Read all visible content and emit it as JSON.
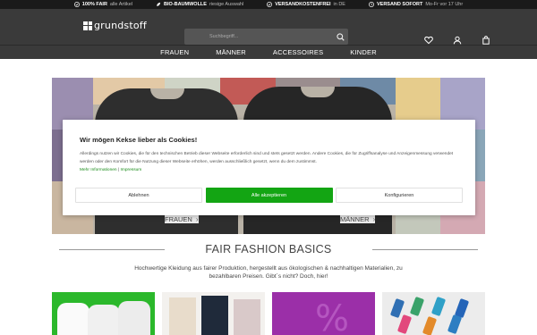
{
  "usp": [
    {
      "icon": "check-circle-icon",
      "bold": "100% FAIR",
      "thin": "alle Artikel"
    },
    {
      "icon": "leaf-icon",
      "bold": "BIO-BAUMWOLLE",
      "thin": "riesige Auswahl"
    },
    {
      "icon": "check-circle-icon",
      "bold": "VERSANDKOSTENFREI",
      "thin": "in DE"
    },
    {
      "icon": "clock-icon",
      "bold": "VERSAND SOFORT",
      "thin": "Mo-Fr vor 17 Uhr"
    }
  ],
  "header": {
    "logo_text": "grundstoff",
    "search_placeholder": "Suchbegriff...",
    "icons": [
      "heart-icon",
      "user-icon",
      "bag-icon"
    ]
  },
  "nav": [
    "FRAUEN",
    "MÄNNER",
    "ACCESSOIRES",
    "KINDER"
  ],
  "hero": {
    "label_left": "FRAUEN",
    "label_right": "MÄNNER"
  },
  "cookie": {
    "title": "Wir mögen Kekse lieber als Cookies!",
    "text": "Allerdings nutzen wir Cookies, die für den technischen Betrieb dieser Webseite erforderlich sind und stets gesetzt werden. Andere Cookies, die für Zugriffsanalyse und Anzeigenmessung verwendet werden oder den Komfort für die Nutzung dieser Webseite erhöhen, werden ausschließlich gesetzt, wenn du dem zustimmst.",
    "link_more": "Mehr Informationen",
    "separator": "|",
    "link_imprint": "Impressum",
    "btn_reject": "Ablehnen",
    "btn_accept": "Alle akzeptieren",
    "btn_configure": "Konfigurieren"
  },
  "section": {
    "title": "FAIR FASHION BASICS",
    "subtitle": "Hochwertige Kleidung aus fairer Produktion, hergestellt aus ökologischen & nachhaltigen Materialien, zu bezahlbaren Preisen. Gibt´s nicht? Doch, hier!"
  },
  "colors": {
    "accent_green": "#13a513",
    "header_dark": "#3a3a3a",
    "usp_bar": "#1a1a1a"
  }
}
